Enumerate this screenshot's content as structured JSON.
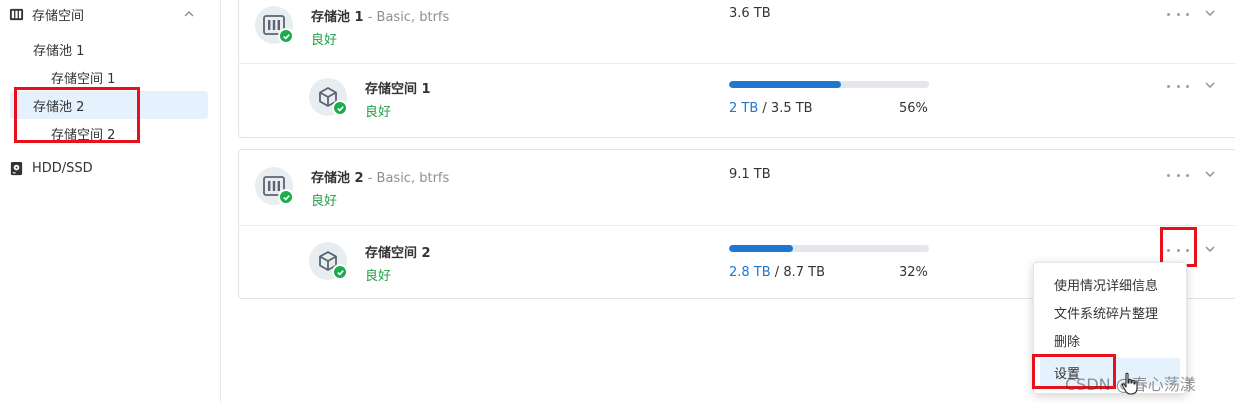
{
  "sidebar": {
    "section_label": "存储空间",
    "items": [
      {
        "label": "存储池 1"
      },
      {
        "label": "存储空间 1"
      },
      {
        "label": "存储池 2"
      },
      {
        "label": "存储空间 2"
      }
    ],
    "hdd_label": "HDD/SSD"
  },
  "pools": [
    {
      "name": "存储池 1",
      "detail": " - Basic, btrfs",
      "status": "良好",
      "capacity": "3.6 TB",
      "volume": {
        "name": "存储空间 1",
        "status": "良好",
        "used": "2 TB",
        "separator": " / ",
        "total": "3.5 TB",
        "percent_label": "56%",
        "percent": 56
      }
    },
    {
      "name": "存储池 2",
      "detail": " - Basic, btrfs",
      "status": "良好",
      "capacity": "9.1 TB",
      "volume": {
        "name": "存储空间 2",
        "status": "良好",
        "used": "2.8 TB",
        "separator": " / ",
        "total": "8.7 TB",
        "percent_label": "32%",
        "percent": 32
      }
    }
  ],
  "menu": {
    "items": [
      {
        "label": "使用情况详细信息"
      },
      {
        "label": "文件系统碎片整理"
      },
      {
        "label": "删除"
      },
      {
        "label": "设置"
      }
    ]
  },
  "watermark": "CSDN @春心荡漾",
  "colors": {
    "accent": "#1e78d2",
    "ok_green": "#21a048",
    "highlight_red": "#e8111b",
    "selected_bg": "#e5f1fc"
  }
}
